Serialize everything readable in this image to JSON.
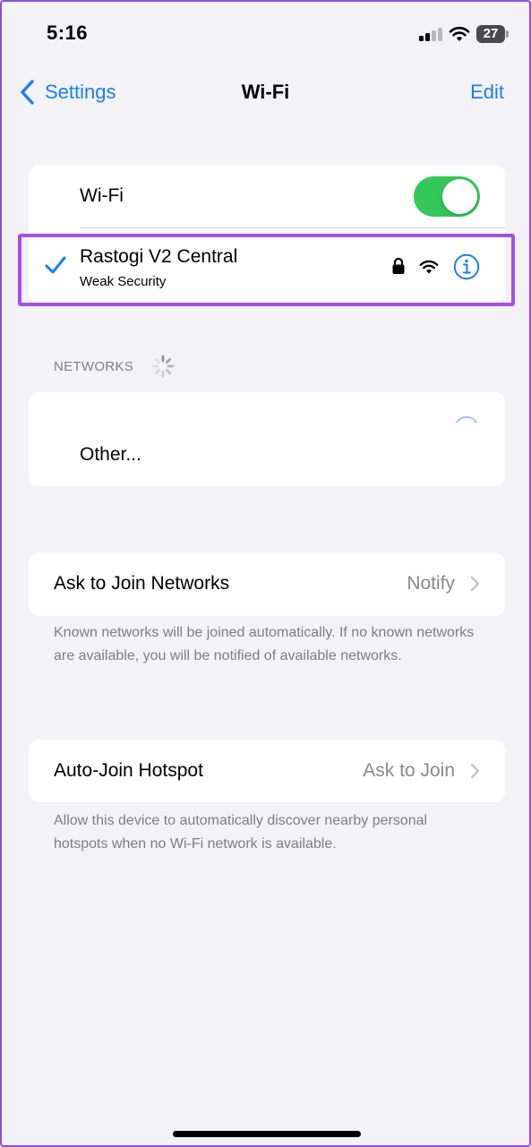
{
  "status_bar": {
    "time": "5:16",
    "battery": "27"
  },
  "nav": {
    "back_label": "Settings",
    "title": "Wi-Fi",
    "edit_label": "Edit"
  },
  "wifi_card": {
    "toggle_label": "Wi-Fi",
    "toggle_on": true,
    "connected_network": {
      "name": "Rastogi V2 Central",
      "subtitle": "Weak Security",
      "icons": [
        "checkmark-icon",
        "lock-icon",
        "wifi-signal-icon",
        "info-icon"
      ]
    }
  },
  "networks_section": {
    "header": "NETWORKS",
    "other_label": "Other..."
  },
  "ask_to_join": {
    "label": "Ask to Join Networks",
    "value": "Notify",
    "footer": "Known networks will be joined automatically. If no known networks are available, you will be notified of available networks."
  },
  "auto_join_hotspot": {
    "label": "Auto-Join Hotspot",
    "value": "Ask to Join",
    "footer": "Allow this device to automatically discover nearby personal hotspots when no Wi-Fi network is available."
  },
  "colors": {
    "accent": "#1a7ef4",
    "toggle_on": "#34c759",
    "highlight": "#a550e6",
    "background": "#f2f2f7",
    "secondary_text": "#8a8a8e"
  }
}
